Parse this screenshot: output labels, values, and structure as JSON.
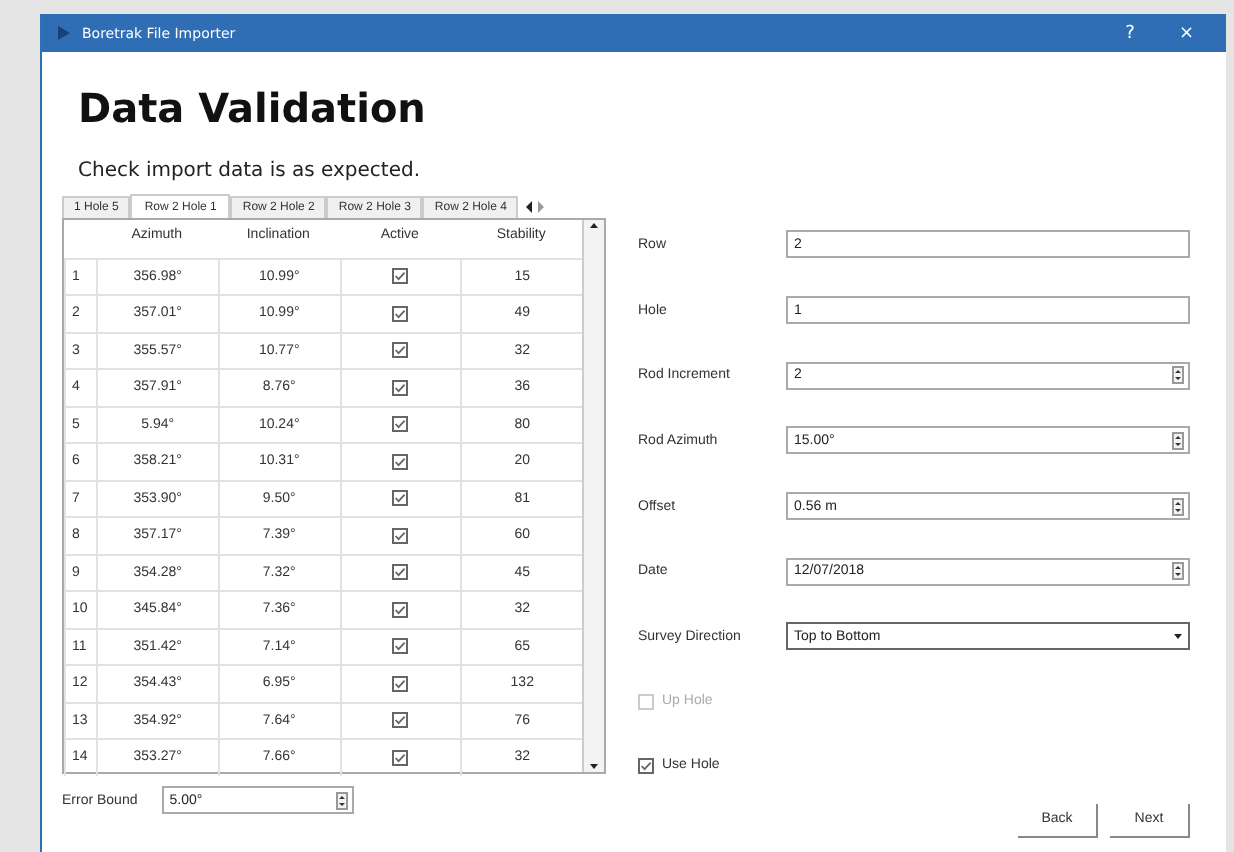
{
  "window": {
    "title": "Boretrak File Importer",
    "help": "?",
    "close": "×"
  },
  "heading": "Data Validation",
  "subtitle": "Check import data is as expected.",
  "tabs": [
    {
      "label": "1 Hole 5",
      "selected": false
    },
    {
      "label": "Row 2 Hole 1",
      "selected": true
    },
    {
      "label": "Row 2 Hole 2",
      "selected": false
    },
    {
      "label": "Row 2 Hole 3",
      "selected": false
    },
    {
      "label": "Row 2 Hole 4",
      "selected": false
    }
  ],
  "table": {
    "columns": [
      "Azimuth",
      "Inclination",
      "Active",
      "Stability"
    ],
    "rows": [
      {
        "index": "1",
        "azimuth": "356.98°",
        "inclination": "10.99°",
        "active": true,
        "stability": "15"
      },
      {
        "index": "2",
        "azimuth": "357.01°",
        "inclination": "10.99°",
        "active": true,
        "stability": "49"
      },
      {
        "index": "3",
        "azimuth": "355.57°",
        "inclination": "10.77°",
        "active": true,
        "stability": "32"
      },
      {
        "index": "4",
        "azimuth": "357.91°",
        "inclination": "8.76°",
        "active": true,
        "stability": "36"
      },
      {
        "index": "5",
        "azimuth": "5.94°",
        "inclination": "10.24°",
        "active": true,
        "stability": "80"
      },
      {
        "index": "6",
        "azimuth": "358.21°",
        "inclination": "10.31°",
        "active": true,
        "stability": "20"
      },
      {
        "index": "7",
        "azimuth": "353.90°",
        "inclination": "9.50°",
        "active": true,
        "stability": "81"
      },
      {
        "index": "8",
        "azimuth": "357.17°",
        "inclination": "7.39°",
        "active": true,
        "stability": "60"
      },
      {
        "index": "9",
        "azimuth": "354.28°",
        "inclination": "7.32°",
        "active": true,
        "stability": "45"
      },
      {
        "index": "10",
        "azimuth": "345.84°",
        "inclination": "7.36°",
        "active": true,
        "stability": "32"
      },
      {
        "index": "11",
        "azimuth": "351.42°",
        "inclination": "7.14°",
        "active": true,
        "stability": "65"
      },
      {
        "index": "12",
        "azimuth": "354.43°",
        "inclination": "6.95°",
        "active": true,
        "stability": "132"
      },
      {
        "index": "13",
        "azimuth": "354.92°",
        "inclination": "7.64°",
        "active": true,
        "stability": "76"
      },
      {
        "index": "14",
        "azimuth": "353.27°",
        "inclination": "7.66°",
        "active": true,
        "stability": "32"
      }
    ]
  },
  "error_bound": {
    "label": "Error Bound",
    "value": "5.00°"
  },
  "fields": [
    {
      "label": "Row",
      "value": "2",
      "kind": "text"
    },
    {
      "label": "Hole",
      "value": "1",
      "kind": "text"
    },
    {
      "label": "Rod Increment",
      "value": "2",
      "kind": "spin"
    },
    {
      "label": "Rod Azimuth",
      "value": "15.00°",
      "kind": "spin"
    },
    {
      "label": "Offset",
      "value": "0.56 m",
      "kind": "spin"
    },
    {
      "label": "Date",
      "value": "12/07/2018",
      "kind": "spin"
    },
    {
      "label": "Survey Direction",
      "value": "Top to Bottom",
      "kind": "combo"
    }
  ],
  "checkboxes": [
    {
      "label": "Up Hole",
      "checked": false,
      "disabled": true
    },
    {
      "label": "Use Hole",
      "checked": true,
      "disabled": false
    }
  ],
  "buttons": [
    "Back",
    "Next"
  ]
}
